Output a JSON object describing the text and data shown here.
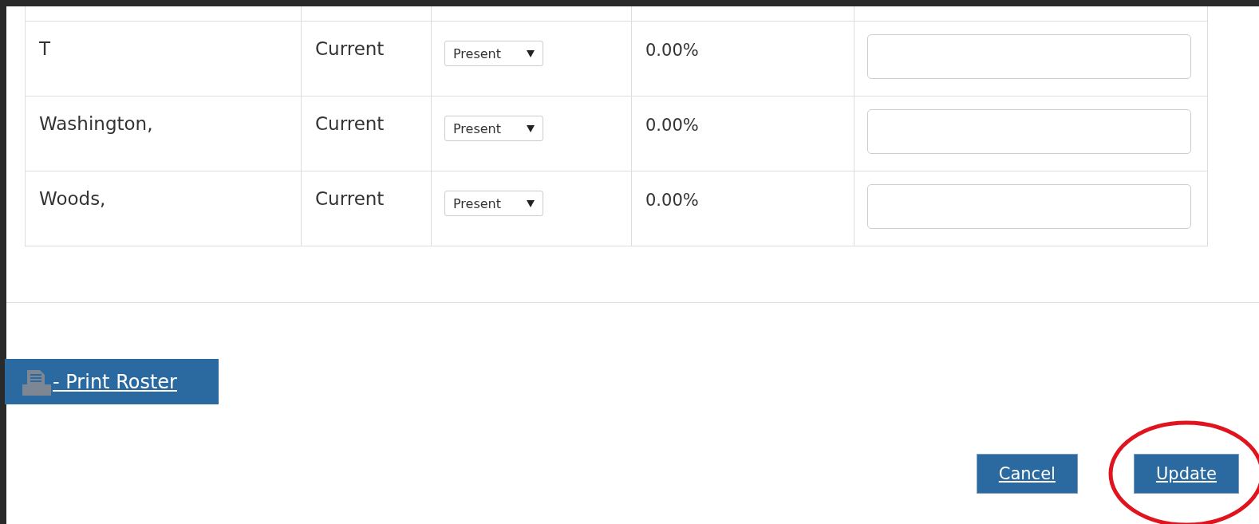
{
  "roster": {
    "rows": [
      {
        "name": "T",
        "status": "Current",
        "attendance": "Present",
        "percent": "0.00%",
        "note": ""
      },
      {
        "name": "Washington,",
        "status": "Current",
        "attendance": "Present",
        "percent": "0.00%",
        "note": ""
      },
      {
        "name": "Woods,",
        "status": "Current",
        "attendance": "Present",
        "percent": "0.00%",
        "note": ""
      }
    ]
  },
  "print_button": {
    "label": "- Print Roster"
  },
  "buttons": [
    {
      "label": "Cancel",
      "highlighted": false
    },
    {
      "label": "Update",
      "highlighted": true
    }
  ]
}
